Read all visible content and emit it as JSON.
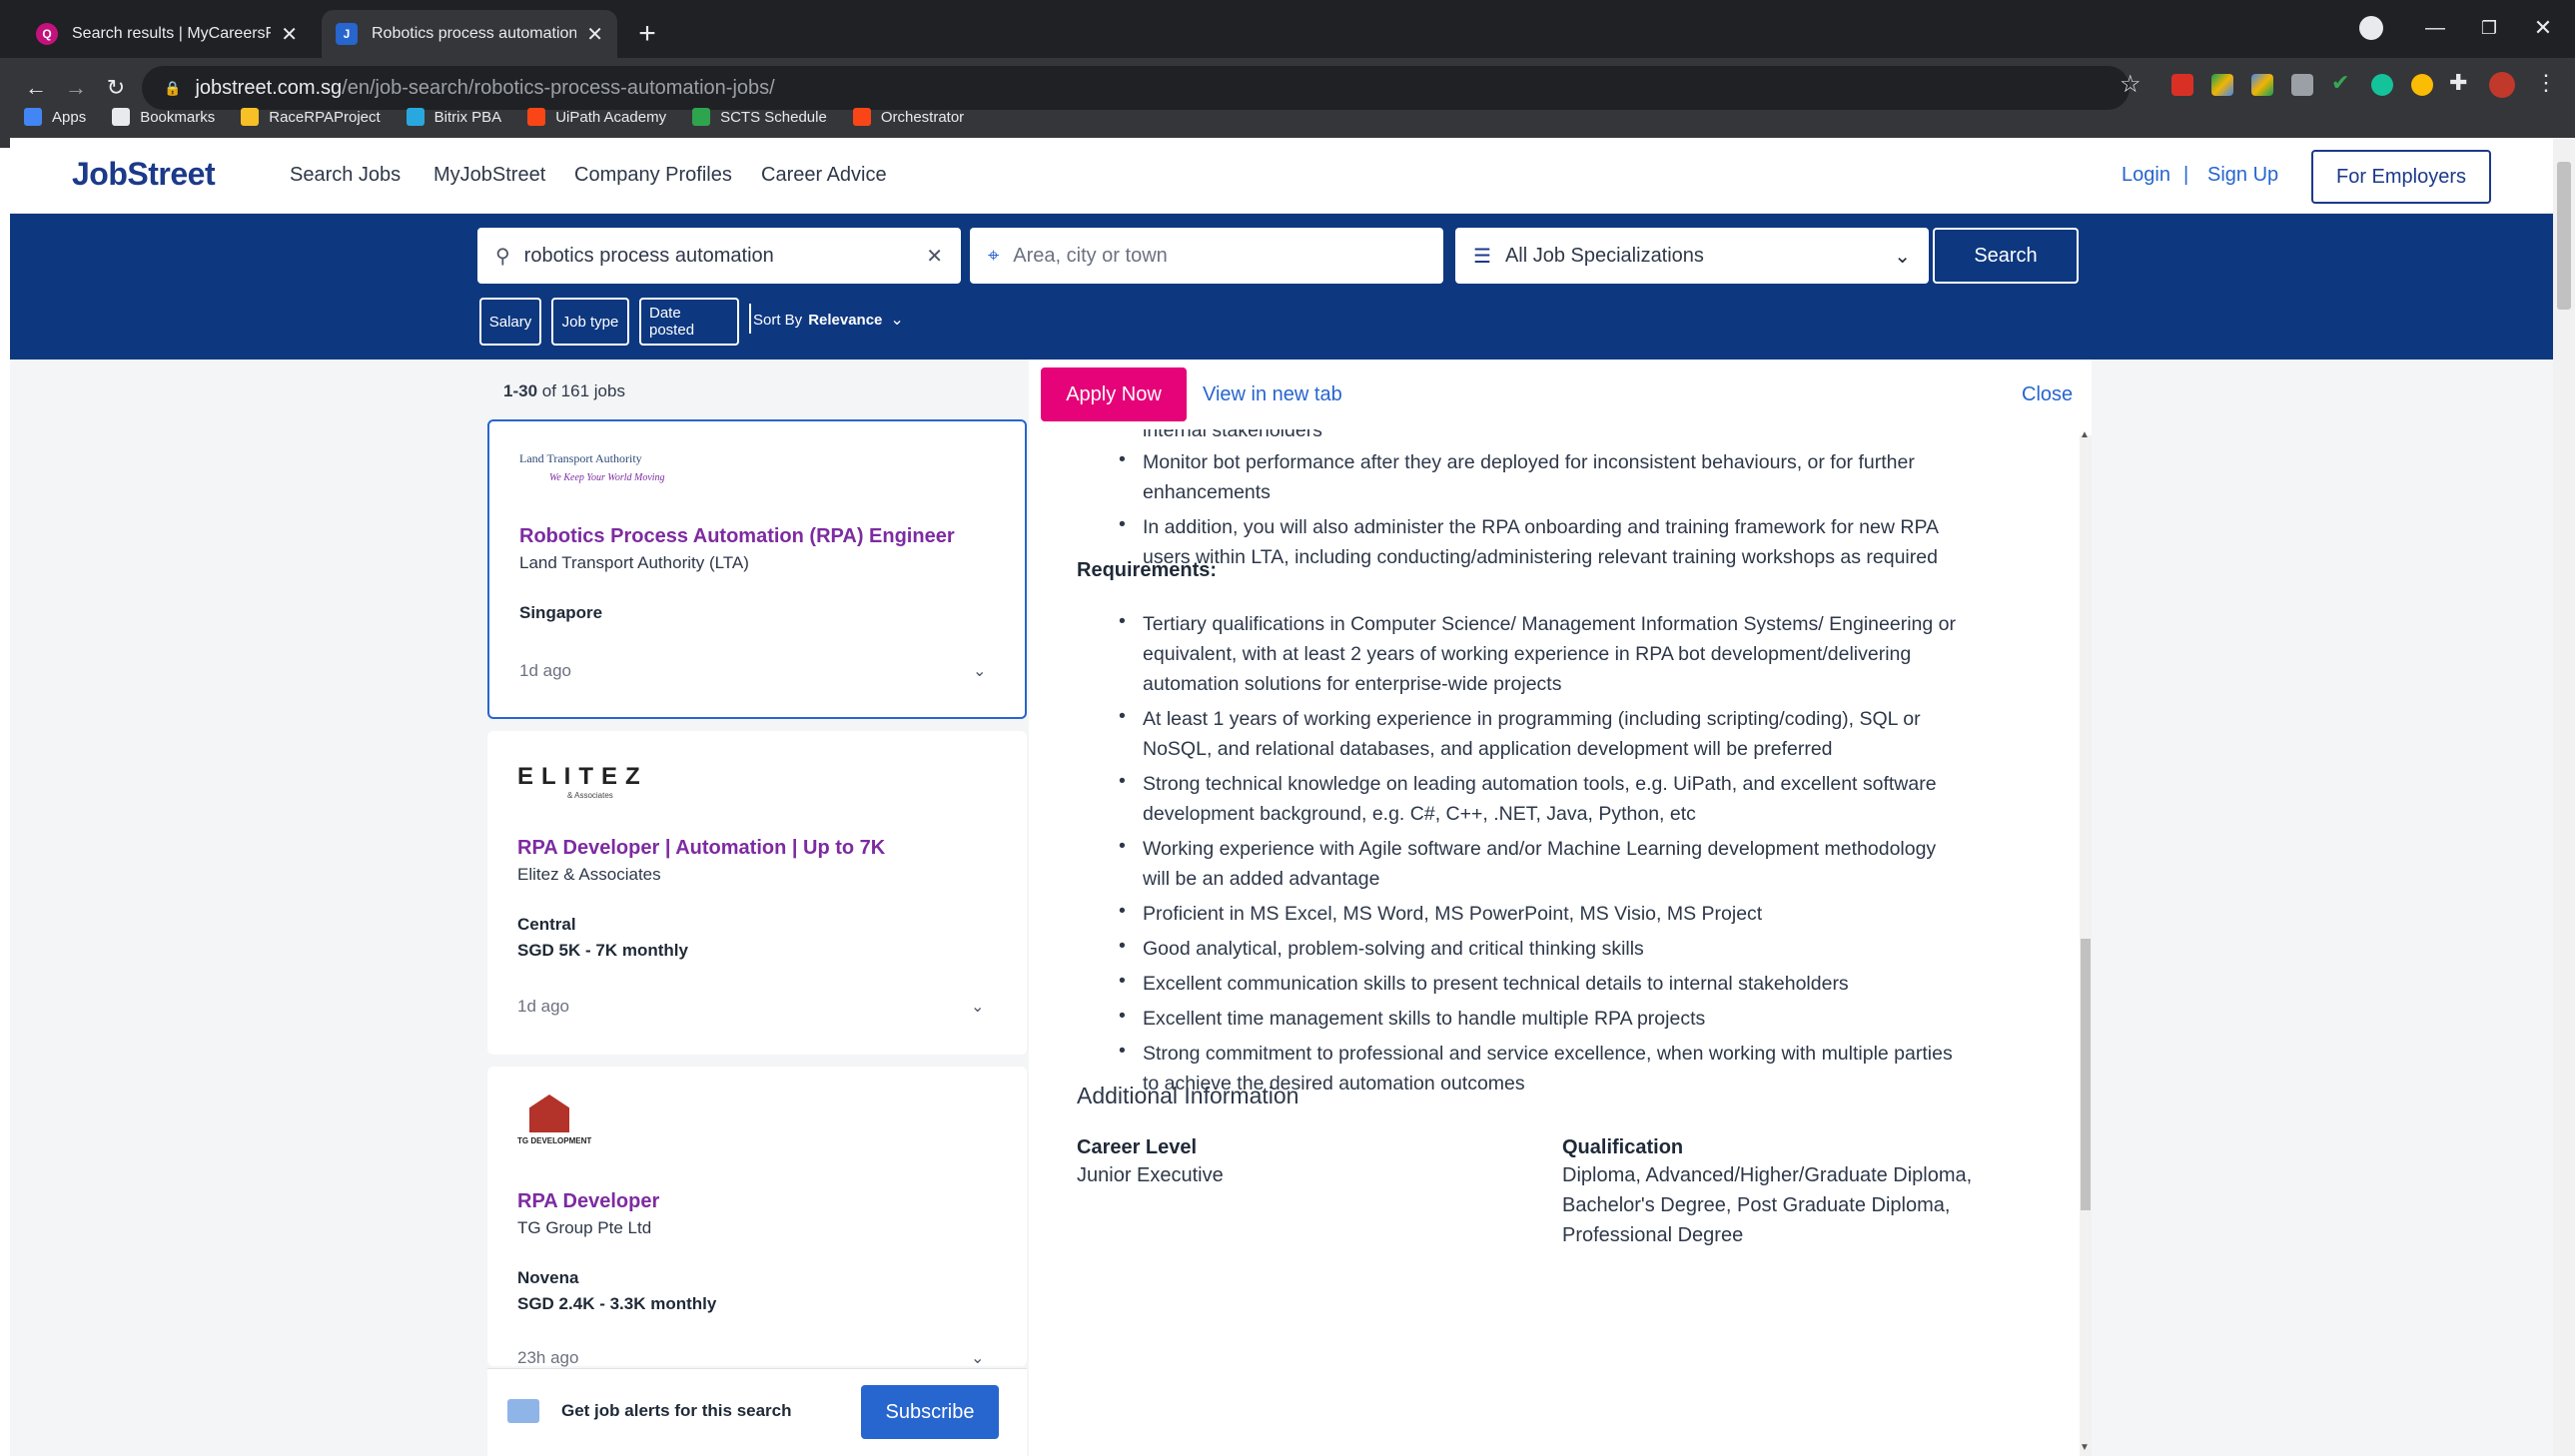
{
  "browser": {
    "tabs": [
      {
        "title": "Search results | MyCareersFuture",
        "favicon_letter": "Q",
        "active": false
      },
      {
        "title": "Robotics process automation Jobs",
        "favicon_letter": "J",
        "active": true
      }
    ],
    "new_tab_label": "+",
    "url_host": "jobstreet.com.sg",
    "url_path": "/en/job-search/robotics-process-automation-jobs/",
    "bookmarks": [
      {
        "label": "Apps",
        "color": "#4285f4"
      },
      {
        "label": "Bookmarks",
        "color": "#e8eaed"
      },
      {
        "label": "RaceRPAProject",
        "color": "#f6c026"
      },
      {
        "label": "Bitrix PBA",
        "color": "#29a8e0"
      },
      {
        "label": "UiPath Academy",
        "color": "#fa4616"
      },
      {
        "label": "SCTS Schedule",
        "color": "#2ea44f"
      },
      {
        "label": "Orchestrator",
        "color": "#fa4616"
      }
    ]
  },
  "header": {
    "logo": "JobStreet",
    "nav": [
      "Search Jobs",
      "MyJobStreet",
      "Company Profiles",
      "Career Advice"
    ],
    "login": "Login",
    "separator": "|",
    "signup": "Sign Up",
    "employers": "For Employers"
  },
  "search": {
    "keyword_value": "robotics process automation",
    "location_placeholder": "Area, city or town",
    "specialization": "All Job Specializations",
    "button": "Search",
    "filters": [
      "Salary",
      "Job type",
      "Date posted"
    ],
    "sort_label": "Sort By",
    "sort_value": "Relevance"
  },
  "results": {
    "range": "1-30",
    "of_text": "of 161 jobs"
  },
  "jobs": [
    {
      "logo_text": "Land Transport Authority",
      "logo_sub": "We Keep Your World Moving",
      "title": "Robotics Process Automation (RPA) Engineer",
      "company": "Land Transport Authority (LTA)",
      "location": "Singapore",
      "salary": "",
      "posted": "1d ago"
    },
    {
      "logo_text": "ELITEZ",
      "logo_sub": "& Associates",
      "title": "RPA Developer | Automation | Up to 7K",
      "company": "Elitez & Associates",
      "location": "Central",
      "salary": "SGD 5K - 7K monthly",
      "posted": "1d ago"
    },
    {
      "logo_text": "TG DEVELOPMENT",
      "logo_sub": "",
      "title": "RPA Developer",
      "company": "TG Group Pte Ltd",
      "location": "Novena",
      "salary": "SGD 2.4K - 3.3K monthly",
      "posted": "23h ago"
    }
  ],
  "alert": {
    "text": "Get job alerts for this search",
    "button": "Subscribe"
  },
  "detail": {
    "apply": "Apply Now",
    "view_new_tab": "View in new tab",
    "close": "Close",
    "top_fragment": "internal stakeholders",
    "responsibilities_tail": [
      [
        "Monitor bot performance after they are deployed for inconsistent behaviours, or for further",
        "enhancements"
      ],
      [
        "In addition, you will also administer the RPA onboarding and training framework for new RPA",
        "users within LTA, including conducting/administering relevant training workshops as required"
      ]
    ],
    "requirements_heading": "Requirements:",
    "requirements": [
      [
        "Tertiary qualifications in Computer Science/ Management Information Systems/ Engineering or",
        "equivalent, with at least 2 years of working experience in RPA bot development/delivering",
        "automation solutions for enterprise-wide projects"
      ],
      [
        "At least 1 years of working experience in programming (including scripting/coding), SQL or",
        "NoSQL, and relational databases, and application development will be preferred"
      ],
      [
        "Strong technical knowledge on leading automation tools, e.g. UiPath, and excellent software",
        "development background, e.g. C#, C++, .NET, Java, Python, etc"
      ],
      [
        "Working experience with Agile software and/or Machine Learning development methodology",
        "will be an added advantage"
      ],
      [
        "Proficient in MS Excel, MS Word, MS PowerPoint, MS Visio, MS Project"
      ],
      [
        "Good analytical, problem-solving and critical thinking skills"
      ],
      [
        "Excellent communication skills to present technical details to internal stakeholders"
      ],
      [
        "Excellent time management skills to handle multiple RPA projects"
      ],
      [
        "Strong commitment to professional and service excellence, when working with multiple parties",
        "to achieve the desired automation outcomes"
      ]
    ],
    "additional_heading": "Additional Information",
    "career_level_label": "Career Level",
    "career_level_value": "Junior Executive",
    "qualification_label": "Qualification",
    "qualification_lines": [
      "Diploma, Advanced/Higher/Graduate Diploma,",
      "Bachelor's Degree, Post Graduate Diploma,",
      "Professional Degree"
    ]
  }
}
